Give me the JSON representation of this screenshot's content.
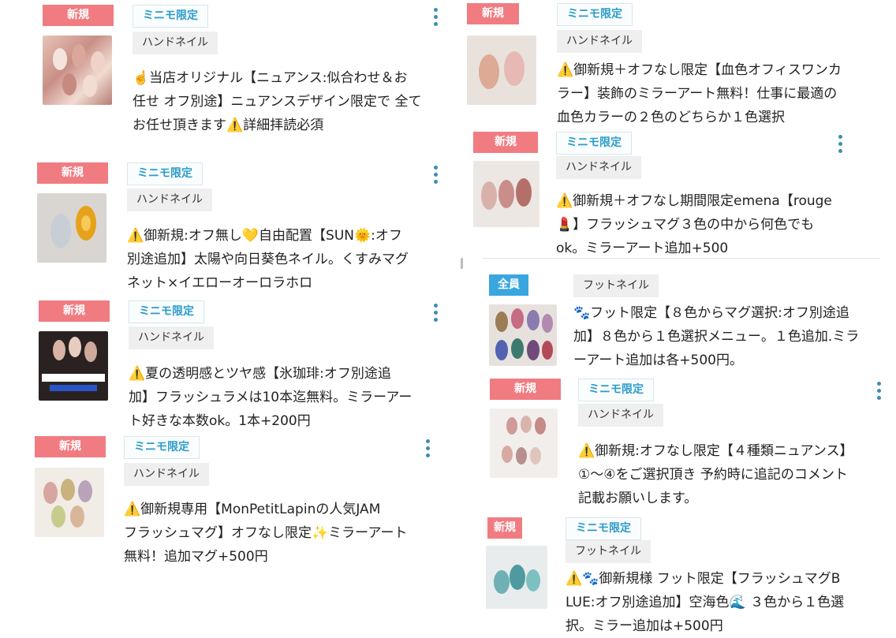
{
  "listings": [
    {
      "badge": "新規",
      "tag": "ミニモ限定",
      "category": "ハンドネイル",
      "thumb_icon": "nail-photo-nuance",
      "description": "☝️当店オリジナル【ニュアンス:似合わせ＆お\n任せ オフ別途】ニュアンスデザイン限定で 全て\nお任せ頂きます⚠️詳細拝読必須"
    },
    {
      "badge": "新規",
      "tag": "ミニモ限定",
      "category": "ハンドネイル",
      "thumb_icon": "nail-photo-sun",
      "description": "⚠️御新規:オフ無し💛自由配置【SUN🌞:オフ\n別途追加】太陽や向日葵色ネイル。くすみマグ\nネット×イエローオーロラホロ"
    },
    {
      "badge": "新規",
      "tag": "ミニモ限定",
      "category": "ハンドネイル",
      "thumb_icon": "nail-photo-summer",
      "description": "⚠️夏の透明感とツヤ感【氷珈琲:オフ別途追\n加】フラッシュラメは10本迄無料。ミラーアー\nト好きな本数ok。1本+200円"
    },
    {
      "badge": "新規",
      "tag": "ミニモ限定",
      "category": "ハンドネイル",
      "thumb_icon": "nail-photo-jam",
      "description": "⚠️御新規専用【MonPetitLapinの人気JAM\nフラッシュマグ】オフなし限定✨ミラーアート\n無料！追加マグ+500円"
    },
    {
      "badge": "新規",
      "tag": "ミニモ限定",
      "category": "ハンドネイル",
      "thumb_icon": "nail-photo-office",
      "description": "⚠️御新規＋オフなし限定【血色オフィスワンカ\nラー】装飾のミラーアート無料！仕事に最適の\n血色カラーの２色のどちらか１色選択"
    },
    {
      "badge": "新規",
      "tag": "ミニモ限定",
      "category": "ハンドネイル",
      "thumb_icon": "nail-photo-rouge",
      "description": "⚠️御新規＋オフなし期間限定emena【rouge\n💄】フラッシュマグ３色の中から何色でも\nok。ミラーアート追加+500"
    },
    {
      "badge": "全員",
      "tag": "",
      "category": "フットネイル",
      "thumb_icon": "nail-photo-foot",
      "description": "🐾フット限定【８色からマグ選択:オフ別途追\n加】８色から１色選択メニュー。１色追加.ミラ\nーアート追加は各+500円。"
    },
    {
      "badge": "新規",
      "tag": "ミニモ限定",
      "category": "ハンドネイル",
      "thumb_icon": "nail-photo-four",
      "description": "⚠️御新規:オフなし限定【４種類ニュアンス】\n①〜④をご選択頂き 予約時に追記のコメント\n記載お願いします。"
    },
    {
      "badge": "新規",
      "tag": "ミニモ限定",
      "category": "フットネイル",
      "thumb_icon": "nail-photo-blue",
      "description": "⚠️🐾御新規様 フット限定【フラッシュマグB\nLUE:オフ別途追加】空海色🌊 ３色から１色選\n択。ミラー追加は+500円"
    }
  ],
  "icons": {
    "more": "kebab-icon"
  }
}
